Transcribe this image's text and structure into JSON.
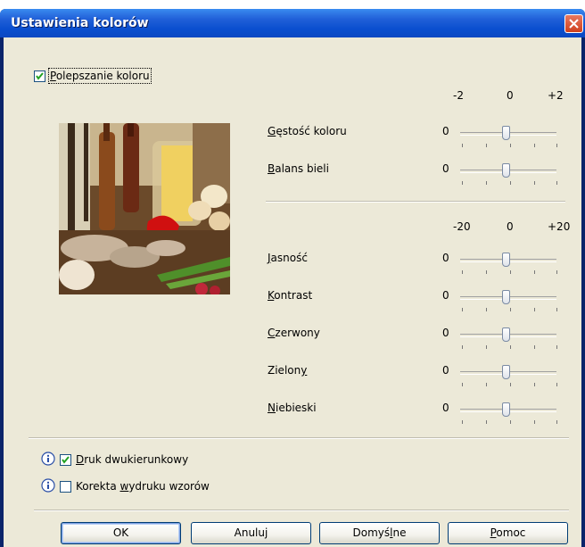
{
  "window": {
    "title": "Ustawienia kolorów"
  },
  "enhance": {
    "label_pre": "",
    "label_u": "P",
    "label_post": "olepszanie koloru",
    "checked": true
  },
  "group1": {
    "scale": {
      "min": "-2",
      "mid": "0",
      "max": "+2"
    },
    "rows": [
      {
        "pre": "",
        "u": "G",
        "post": "ęstość koloru",
        "value": "0"
      },
      {
        "pre": "",
        "u": "B",
        "post": "alans bieli",
        "value": "0"
      }
    ]
  },
  "group2": {
    "scale": {
      "min": "-20",
      "mid": "0",
      "max": "+20"
    },
    "rows": [
      {
        "pre": "",
        "u": "J",
        "post": "asność",
        "value": "0"
      },
      {
        "pre": "",
        "u": "K",
        "post": "ontrast",
        "value": "0"
      },
      {
        "pre": "",
        "u": "C",
        "post": "zerwony",
        "value": "0"
      },
      {
        "pre": "Zielon",
        "u": "y",
        "post": "",
        "value": "0"
      },
      {
        "pre": "",
        "u": "N",
        "post": "iebieski",
        "value": "0"
      }
    ]
  },
  "options": [
    {
      "pre": "",
      "u": "D",
      "post": "ruk dwukierunkowy",
      "checked": true,
      "icon": "info-icon"
    },
    {
      "pre": "Korekta ",
      "u": "w",
      "post": "ydruku wzorów",
      "checked": false,
      "icon": "info-icon"
    }
  ],
  "buttons": {
    "ok": "OK",
    "cancel": "Anuluj",
    "default_pre": "Domyś",
    "default_u": "l",
    "default_post": "ne",
    "help_pre": "",
    "help_u": "P",
    "help_post": "omoc"
  },
  "colors": {
    "titlebar": "#0a4fcf",
    "dialog_bg": "#ece9d8",
    "close": "#d0401c",
    "check": "#21a121"
  }
}
